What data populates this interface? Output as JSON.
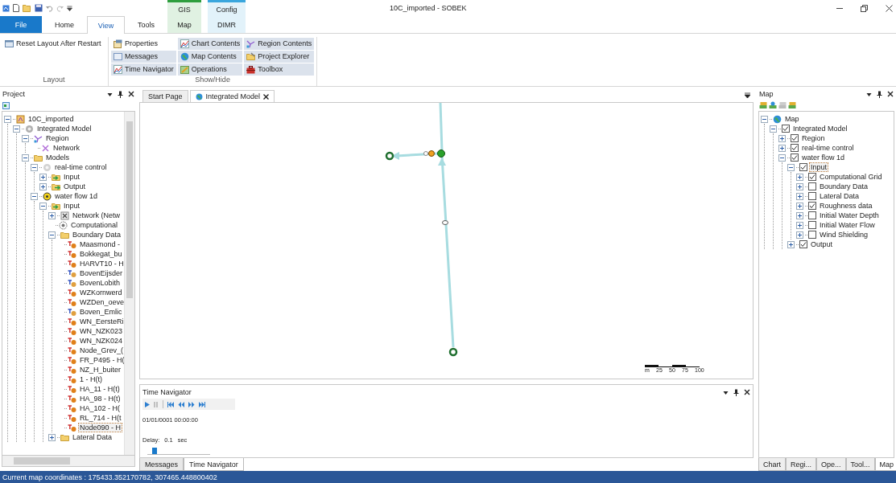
{
  "window": {
    "title": "10C_imported - SOBEK"
  },
  "ribbon_tabs": [
    {
      "label": "File",
      "kind": "file",
      "selected": false
    },
    {
      "label": "Home",
      "kind": "plain",
      "selected": false
    },
    {
      "label": "View",
      "kind": "plain",
      "selected": true
    },
    {
      "label": "Tools",
      "kind": "plain",
      "selected": false
    },
    {
      "label": "Map",
      "kind": "context",
      "context": "GIS",
      "color": "#2e9e3e",
      "selected": false
    },
    {
      "label": "DIMR",
      "kind": "context",
      "context": "Config",
      "color": "#3aa6dd",
      "selected": false
    }
  ],
  "ribbon_groups": [
    {
      "label": "Layout",
      "items": [
        {
          "label": "Reset Layout After Restart",
          "kind": "layout"
        }
      ]
    },
    {
      "label": "Show/Hide",
      "items": [
        {
          "label": "Properties",
          "kind": "properties",
          "on": false
        },
        {
          "label": "Messages",
          "kind": "messages",
          "on": true
        },
        {
          "label": "Time Navigator",
          "kind": "chart",
          "on": true
        },
        {
          "label": "Chart Contents",
          "kind": "chart",
          "on": true
        },
        {
          "label": "Map Contents",
          "kind": "globe",
          "on": true
        },
        {
          "label": "Operations",
          "kind": "operations",
          "on": true
        },
        {
          "label": "Region Contents",
          "kind": "region",
          "on": true
        },
        {
          "label": "Project Explorer",
          "kind": "explorer",
          "on": true
        },
        {
          "label": "Toolbox",
          "kind": "toolbox",
          "on": true
        }
      ]
    }
  ],
  "project_panel": {
    "title": "Project",
    "tree": [
      {
        "label": "10C_imported",
        "kind": "project",
        "expanded": true,
        "selected": false,
        "children": [
          {
            "label": "Integrated Model",
            "kind": "model",
            "expanded": true,
            "selected": false,
            "children": [
              {
                "label": "Region",
                "kind": "region",
                "expanded": true,
                "selected": false,
                "children": [
                  {
                    "label": "Network",
                    "kind": "network",
                    "selected": false
                  }
                ]
              },
              {
                "label": "Models",
                "kind": "folder",
                "expanded": true,
                "selected": false,
                "children": [
                  {
                    "label": "real-time control",
                    "kind": "rtc",
                    "expanded": true,
                    "selected": false,
                    "children": [
                      {
                        "label": "Input",
                        "kind": "input",
                        "expanded": false,
                        "selected": false
                      },
                      {
                        "label": "Output",
                        "kind": "output",
                        "expanded": false,
                        "selected": false
                      }
                    ]
                  },
                  {
                    "label": "water flow 1d",
                    "kind": "flow",
                    "expanded": true,
                    "selected": false,
                    "children": [
                      {
                        "label": "Input",
                        "kind": "input",
                        "expanded": true,
                        "selected": false,
                        "children": [
                          {
                            "label": "Network (Netw",
                            "kind": "network-file",
                            "expanded": false,
                            "selected": false
                          },
                          {
                            "label": "Computational",
                            "kind": "grid",
                            "selected": false
                          },
                          {
                            "label": "Boundary Data",
                            "kind": "folder",
                            "expanded": true,
                            "selected": false,
                            "children": [
                              {
                                "label": "Maasmond -",
                                "kind": "boundary-h",
                                "selected": false
                              },
                              {
                                "label": "Bokkegat_bu",
                                "kind": "boundary-h",
                                "selected": false
                              },
                              {
                                "label": "HARVT10 - H",
                                "kind": "boundary-h",
                                "selected": false
                              },
                              {
                                "label": "BovenEijsder",
                                "kind": "boundary-q",
                                "selected": false
                              },
                              {
                                "label": "BovenLobith",
                                "kind": "boundary-q",
                                "selected": false
                              },
                              {
                                "label": "WZKornwerd",
                                "kind": "boundary-h",
                                "selected": false
                              },
                              {
                                "label": "WZDen_oeve",
                                "kind": "boundary-h",
                                "selected": false
                              },
                              {
                                "label": "Boven_Emlic",
                                "kind": "boundary-q",
                                "selected": false
                              },
                              {
                                "label": "WN_EersteRi",
                                "kind": "boundary-h",
                                "selected": false
                              },
                              {
                                "label": "WN_NZK023",
                                "kind": "boundary-h",
                                "selected": false
                              },
                              {
                                "label": "WN_NZK024",
                                "kind": "boundary-h",
                                "selected": false
                              },
                              {
                                "label": "Node_Grev_(",
                                "kind": "boundary-h",
                                "selected": false
                              },
                              {
                                "label": "FR_P495 - H(",
                                "kind": "boundary-h",
                                "selected": false
                              },
                              {
                                "label": "NZ_H_buiter",
                                "kind": "boundary-h",
                                "selected": false
                              },
                              {
                                "label": "1 - H(t)",
                                "kind": "boundary-h",
                                "selected": false
                              },
                              {
                                "label": "HA_11 - H(t)",
                                "kind": "boundary-h",
                                "selected": false
                              },
                              {
                                "label": "HA_98 - H(t)",
                                "kind": "boundary-h",
                                "selected": false
                              },
                              {
                                "label": "HA_102 - H(",
                                "kind": "boundary-h",
                                "selected": false
                              },
                              {
                                "label": "RL_714 - H(t",
                                "kind": "boundary-h",
                                "selected": false
                              },
                              {
                                "label": "Node090 - H",
                                "kind": "boundary-h",
                                "selected": true
                              }
                            ]
                          },
                          {
                            "label": "Lateral Data",
                            "kind": "folder",
                            "expanded": false,
                            "selected": false
                          }
                        ]
                      }
                    ]
                  }
                ]
              }
            ]
          }
        ]
      }
    ]
  },
  "document_tabs": [
    {
      "label": "Start Page",
      "selected": false
    },
    {
      "label": "Integrated Model",
      "selected": true
    }
  ],
  "map_view": {
    "scale_labels": [
      "m",
      "25",
      "50",
      "75",
      "100"
    ]
  },
  "time_navigator": {
    "title": "Time Navigator",
    "time": "01/01/0001 00:00:00",
    "delay_label": "Delay:",
    "delay_value": "0.1",
    "delay_unit": "sec",
    "level": 0.08
  },
  "bottom_tabs": [
    {
      "label": "Messages",
      "selected": false
    },
    {
      "label": "Time Navigator",
      "selected": true
    }
  ],
  "map_panel": {
    "title": "Map",
    "tree": [
      {
        "label": "Map",
        "kind": "globe",
        "expanded": true,
        "selected": false,
        "children": [
          {
            "label": "Integrated Model",
            "checked": true,
            "expanded": true,
            "selected": false,
            "children": [
              {
                "label": "Region",
                "checked": true,
                "expanded": false,
                "selected": false
              },
              {
                "label": "real-time control",
                "checked": true,
                "expanded": false,
                "selected": false
              },
              {
                "label": "water flow 1d",
                "checked": true,
                "expanded": true,
                "selected": false,
                "children": [
                  {
                    "label": "Input",
                    "checked": true,
                    "expanded": true,
                    "selected": true,
                    "children": [
                      {
                        "label": "Computational Grid",
                        "checked": true,
                        "expanded": false,
                        "selected": false
                      },
                      {
                        "label": "Boundary Data",
                        "checked": false,
                        "expanded": false,
                        "selected": false
                      },
                      {
                        "label": "Lateral Data",
                        "checked": false,
                        "expanded": false,
                        "selected": false
                      },
                      {
                        "label": "Roughness data",
                        "checked": true,
                        "expanded": false,
                        "selected": false
                      },
                      {
                        "label": "Initial Water Depth",
                        "checked": false,
                        "expanded": false,
                        "selected": false
                      },
                      {
                        "label": "Initial Water Flow",
                        "checked": false,
                        "expanded": false,
                        "selected": false
                      },
                      {
                        "label": "Wind Shielding",
                        "checked": false,
                        "expanded": false,
                        "selected": false
                      }
                    ]
                  },
                  {
                    "label": "Output",
                    "checked": true,
                    "expanded": false,
                    "selected": false
                  }
                ]
              }
            ]
          }
        ]
      }
    ]
  },
  "right_tabs": [
    {
      "label": "Chart",
      "selected": false
    },
    {
      "label": "Regi...",
      "selected": false
    },
    {
      "label": "Ope...",
      "selected": false
    },
    {
      "label": "Tool...",
      "selected": false
    },
    {
      "label": "Map",
      "selected": true
    }
  ],
  "status_bar": {
    "text": "Current map coordinates : 175433.352170782, 307465.448800402"
  }
}
